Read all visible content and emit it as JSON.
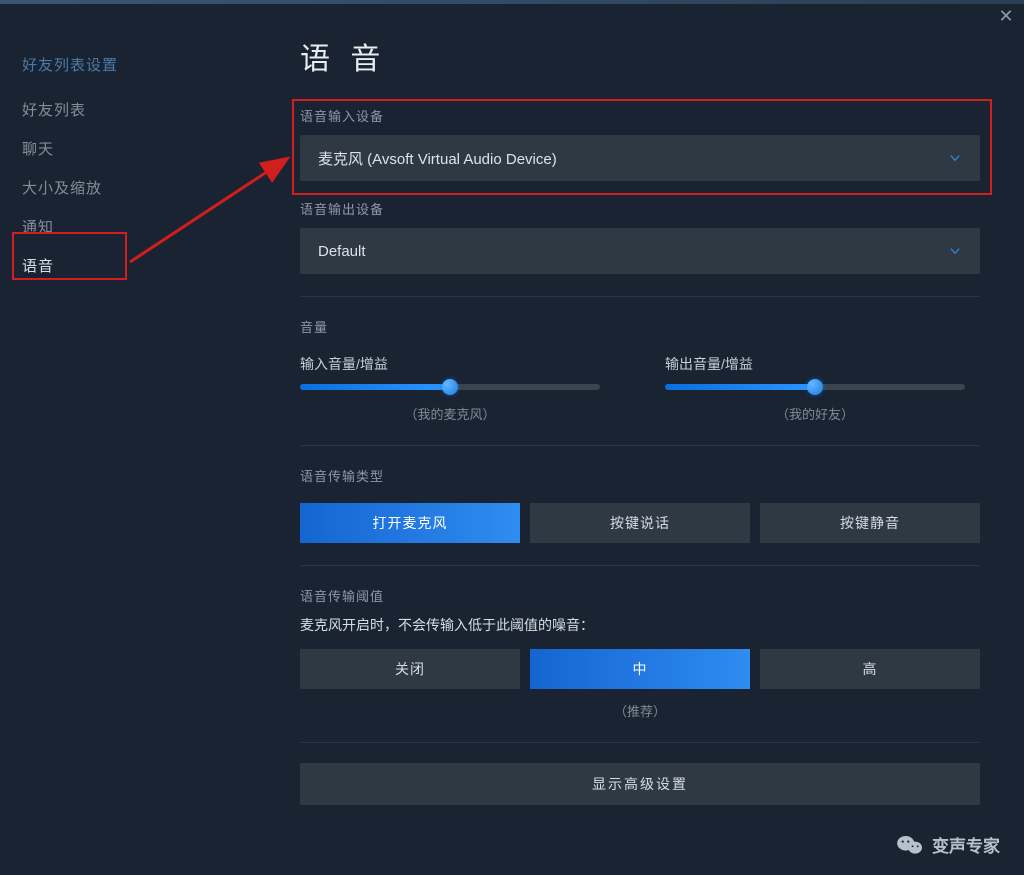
{
  "sidebar": {
    "heading": "好友列表设置",
    "items": [
      {
        "label": "好友列表",
        "active": false
      },
      {
        "label": "聊天",
        "active": false
      },
      {
        "label": "大小及缩放",
        "active": false
      },
      {
        "label": "通知",
        "active": false
      },
      {
        "label": "语音",
        "active": true
      }
    ]
  },
  "page_title": "语 音",
  "input_device": {
    "label": "语音输入设备",
    "value": "麦克风 (Avsoft Virtual Audio Device)"
  },
  "output_device": {
    "label": "语音输出设备",
    "value": "Default"
  },
  "volume": {
    "section_label": "音量",
    "input": {
      "label": "输入音量/增益",
      "sub": "（我的麦克风）",
      "percent": 50
    },
    "output": {
      "label": "输出音量/增益",
      "sub": "（我的好友）",
      "percent": 50
    }
  },
  "transmit_type": {
    "label": "语音传输类型",
    "options": [
      {
        "label": "打开麦克风",
        "active": true
      },
      {
        "label": "按键说话",
        "active": false
      },
      {
        "label": "按键静音",
        "active": false
      }
    ]
  },
  "threshold": {
    "label": "语音传输阈值",
    "desc": "麦克风开启时，不会传输入低于此阈值的噪音：",
    "options": [
      {
        "label": "关闭",
        "active": false
      },
      {
        "label": "中",
        "active": true
      },
      {
        "label": "高",
        "active": false
      }
    ],
    "recommended": "（推荐）"
  },
  "advanced_button": "显示高级设置",
  "watermark": "变声专家",
  "colors": {
    "accent_blue": "#2a86ea",
    "highlight_red": "#d11e1e",
    "bg": "#1a2332",
    "panel": "#2f3944"
  }
}
